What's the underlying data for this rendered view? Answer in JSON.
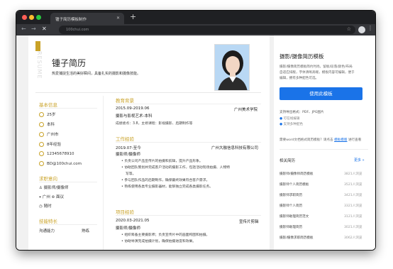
{
  "browser": {
    "tab_title": "锺子简历模板制作",
    "url": "100chui.com"
  },
  "resume": {
    "watermark": "RESUME",
    "title": "锺子简历",
    "subtitle": "热爱捕捉生活的美好瞬间，具备扎实的摄影和摄像技能。",
    "basic": {
      "heading": "基本信息",
      "items": [
        "25岁",
        "本科",
        "广州市",
        "8年经验",
        "12345678910",
        "BD@100chui.com"
      ]
    },
    "job": {
      "heading": "求职意向",
      "position": "摄影师/摄像师",
      "city": "广州",
      "salary": "面议",
      "availability": "随时"
    },
    "skills": {
      "heading": "技能特长",
      "row_label": "沟通能力",
      "row_value": "熟练"
    },
    "education": {
      "heading": "教育背景",
      "period": "2015.09-2019.06",
      "school": "广州美术学院",
      "major": "摄影与影视艺术-本科",
      "grades": "成绩绩点：3.8，主修课程：影视摄影、后期制作等"
    },
    "work": {
      "heading": "工作经验",
      "period": "2019.07-至今",
      "company": "广州大融信息科技有限公司",
      "role": "摄影师/摄像师",
      "bullets": [
        "负责公司产品宣传片的拍摄和剪辑，提升产品形象。",
        "协助团队策划并完成客户活动的摄影工作，包括活动现场拍摄、人物特",
        "写等。",
        "参与团队作品的后期制作，确保最终效果符合客户需求。",
        "熟练使用各类专业摄影器材，能够独立完成各类摄影任务。"
      ]
    },
    "project": {
      "heading": "项目经验",
      "period": "2020.03-2021.05",
      "name": "宣传片剪辑",
      "role": "摄影师/摄像师",
      "bullets": [
        "组织筹备主要摄影师；负责宣传片中的画面构图和拍摄。",
        "协助导演完成拍摄计划，确保拍摄进度和效果。"
      ]
    }
  },
  "sidebar": {
    "title": "摄影/摄像简历模板",
    "desc": [
      "摄影/摄像简历模板简约时尚，留板/段落/颜色/布局",
      "自适应排版，字体清晰高端，模板内容可编辑，便于",
      "编辑，拥有多种配色可选。"
    ],
    "use_button": "使用此模板",
    "export": "支持导出格式：PDF、JPG图片",
    "check1": "可在线编辑",
    "check2": "支持多种配色",
    "word_note": "需要word文档格式简历模板？请点击",
    "word_link": "模板模版",
    "word_tail": "进行查看",
    "related_heading": "相关简历",
    "more": "更多 »",
    "related": [
      {
        "name": "摄影师/摄像师简历模板",
        "count": "3821人浏览"
      },
      {
        "name": "摄影师个人简历模板",
        "count": "3521人浏览"
      },
      {
        "name": "摄影师求职简历",
        "count": "3421人浏览"
      },
      {
        "name": "摄影师个人简历",
        "count": "3321人浏览"
      },
      {
        "name": "摄影师助理简历范文",
        "count": "3121人浏览"
      },
      {
        "name": "摄影师助理简历",
        "count": "3021人浏览"
      },
      {
        "name": "摄影/摄像求职简历模板",
        "count": "3062人浏览"
      }
    ]
  },
  "colors": {
    "accent": "#c9a227",
    "primary_button": "#1a73e8"
  }
}
